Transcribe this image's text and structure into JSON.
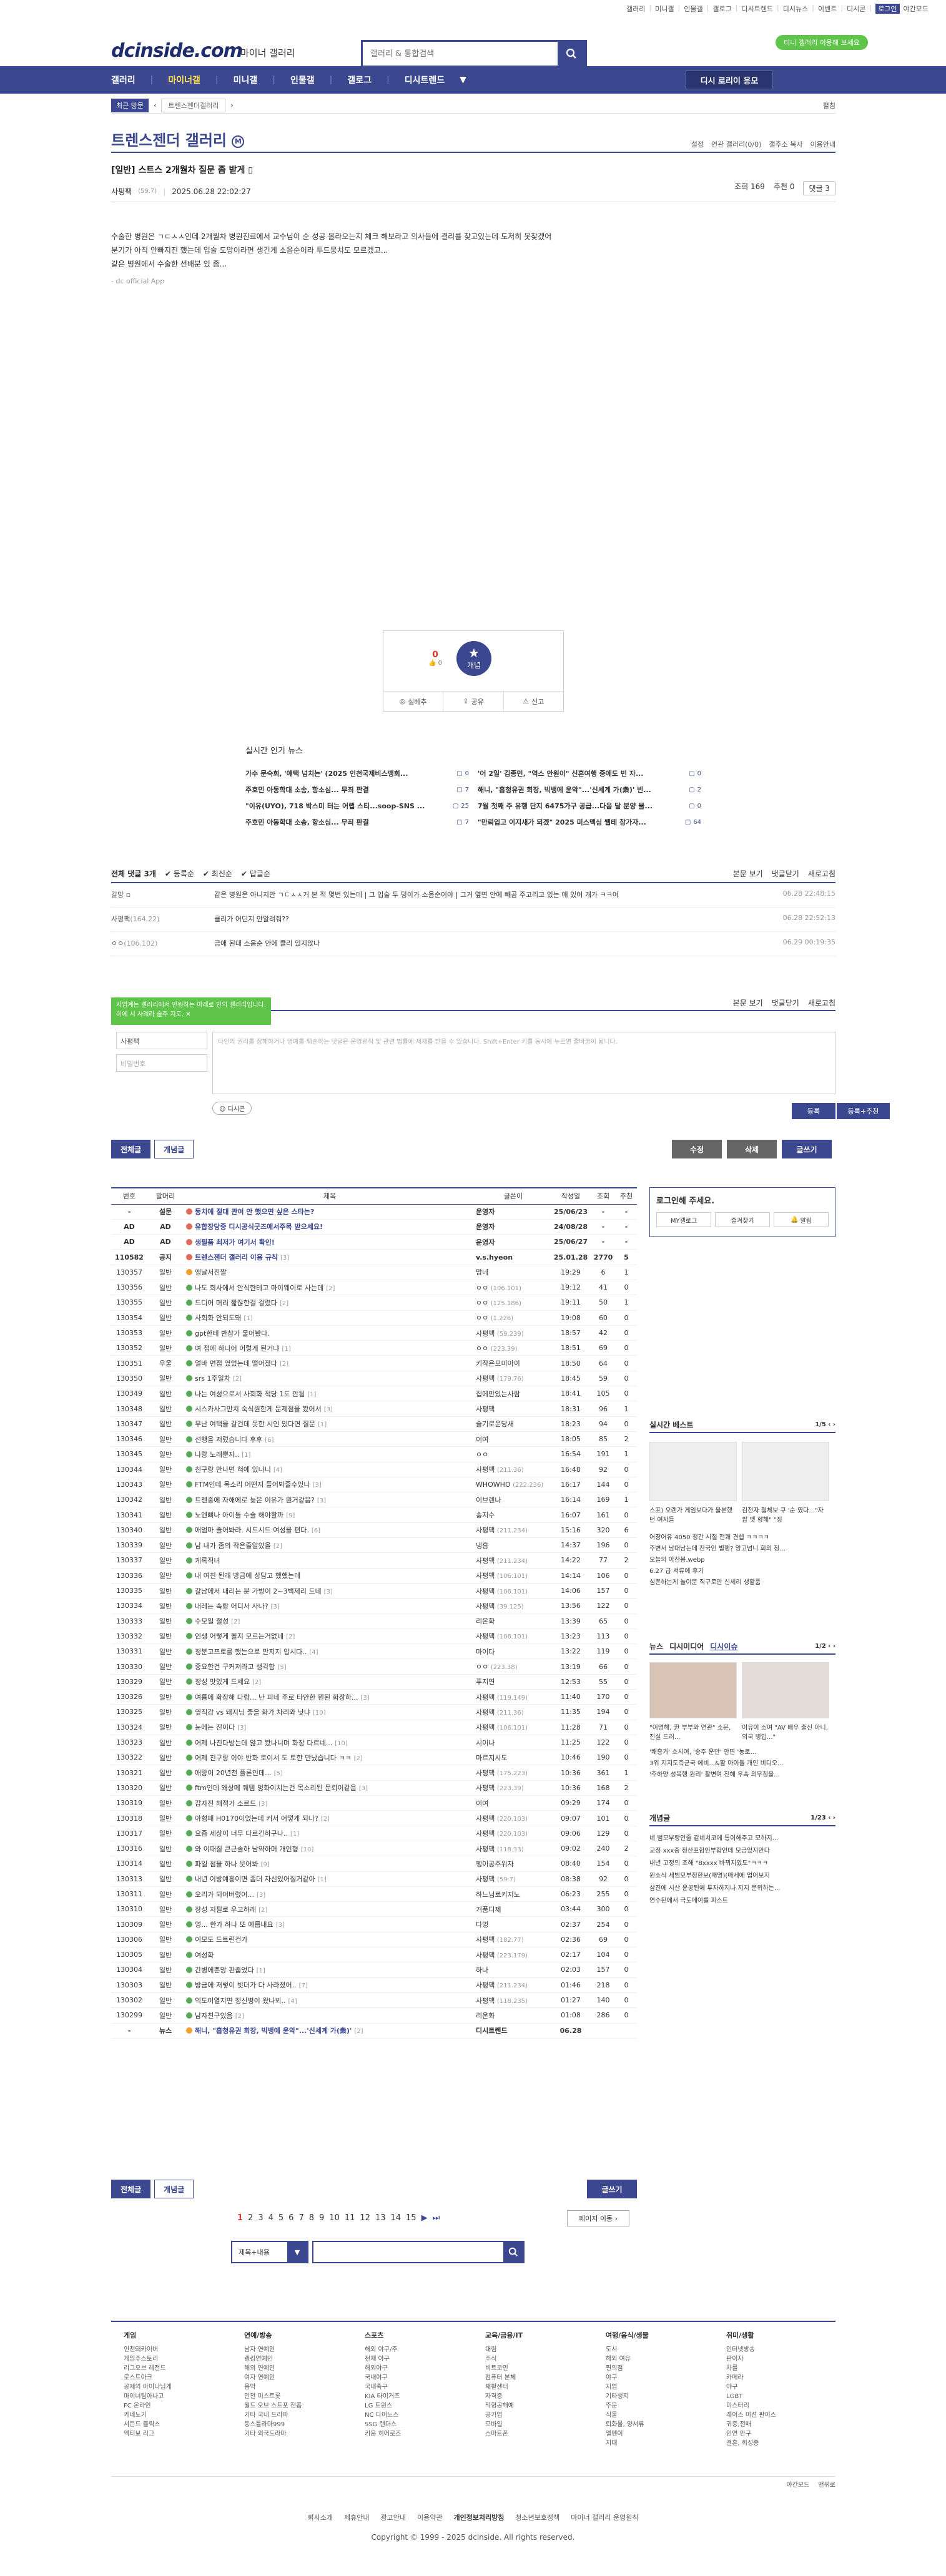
{
  "top_links": [
    "갤러리",
    "미니갤",
    "인물갤",
    "갤로그",
    "디시트렌드",
    "디시뉴스",
    "이벤트",
    "디시콘",
    "로그인",
    "야간모드"
  ],
  "site": {
    "logo": "dcinside.com",
    "section": "마이너 갤러리",
    "search_placeholder": "갤러리 & 통합검색",
    "promo_pill": "미니 갤러리 이용해 보세요"
  },
  "nav": {
    "items": [
      "갤러리",
      "마이너갤",
      "미니갤",
      "인물갤",
      "갤로그",
      "디시트렌드"
    ],
    "active": "마이너갤",
    "promo_btn": "디시 로리이 응모"
  },
  "breadcrumb": {
    "recent": "최근 방문",
    "current": "트렌스젠더갤러리",
    "expand": "펼침"
  },
  "gallery": {
    "title": "트렌스젠더 갤러리",
    "badge": "M",
    "tools": [
      "설정",
      "연관 갤러리(0/0)",
      "갤주소 복사",
      "이용안내"
    ]
  },
  "post": {
    "category": "[일반]",
    "title": "스트스 2개월차 질문 좀 받게",
    "author": "사펑팩",
    "ip": "(59.7)",
    "date": "2025.06.28 22:02:27",
    "views_label": "조회 169",
    "rec_label": "추천 0",
    "comments_label": "댓글 3",
    "body": [
      "수술한 병원은 ㄱㄷㅅㅅ인데 2개월차 병원진료에서 교수님이 순 성공 올라오는지 체크 해보라고 의사들에 결리를 찾고있는데 도저히 못찾겠어",
      "분기가 아직 안빠지진 했는데 입술 도망이라면 생긴게 소음순이라 투드뭉치도 모르겠고...",
      "같은 병원에서 수술한 선배분 있 좀..."
    ],
    "app_tag": "- dc official App"
  },
  "recommend": {
    "up_count": "0",
    "up_label": "0",
    "star_label": "개념",
    "actions": [
      "실베추",
      "공유",
      "신고"
    ]
  },
  "popular": {
    "header": "실시간 인기 뉴스",
    "items": [
      {
        "t": "가수 문숙희, '얘택 넘치는' (2025 인천국제비스맹회...",
        "c": "0"
      },
      {
        "t": "'어 2일' 김종민, \"역스 안원이\" 신혼여행 중에도 빈 자...",
        "c": "0"
      },
      {
        "t": "주호민 아동학대 소송, 항소심... 무죄 판결",
        "c": "7"
      },
      {
        "t": "해니, \"흡청유권 회장, 빅뱅에 윤악\"...'신세계 가(衆)' 빈...",
        "c": "2"
      },
      {
        "t": "\"이유(UYO), 718 박스미 터는 어랩 스티...soop-SNS ...",
        "c": "25"
      },
      {
        "t": "7월 첫째 주 유행 단지 6475가구 공급...다음 달 분양 물...",
        "c": "0"
      },
      {
        "t": "주호민 아동학대 소송, 항소심... 무죄 판결",
        "c": "7"
      },
      {
        "t": "\"만뢰입고 이지새가 되겠\" 2025 미스맥심 웹테 참가자...",
        "c": "64"
      }
    ]
  },
  "comments": {
    "total": "전체 댓글 3개",
    "filters": [
      "등록순",
      "최신순",
      "답글순"
    ],
    "right": [
      "본문 보기",
      "댓글닫기",
      "새로고침"
    ],
    "list": [
      {
        "who": "갈망",
        "ip": "",
        "text": "같은 병원은 아니지만 ㄱㄷㅅㅅ거 본 적 몇번 있는데 | 그 입술 두 덩이가 소음순이야 | 그거 옆면 안에 빼곰 주고리고 있는 애 있어 개가 ㅋㅋ어",
        "dt": "06.28 22:48:15"
      },
      {
        "who": "사펑팩",
        "ip": "(164.22)",
        "text": "클리가 어딘지 안알려줘??",
        "dt": "06.28 22:52:13"
      },
      {
        "who": "ㅇㅇ",
        "ip": "(106.102)",
        "text": "금애 된대 소음순 안에 클리 있지않나",
        "dt": "06.29 00:19:35"
      }
    ]
  },
  "comment_form": {
    "tooltip": "사업계는 갤러리에서 안원하는 아래로 인의 갤러리입니다. 이에 시 사례라 술주 지도.",
    "name": "사평팩",
    "pw_placeholder": "비밀번호",
    "ta_placeholder": "타인의 권리를 침해하거나 명예를 훼손하는 댓글은 운영원칙 및 관련 법률에 제재를 받을 수 있습니다. Shift+Enter 키를 동시에 누르면 줄바꿈이 됩니다.",
    "dccon": "디시콘",
    "reg": "등록",
    "reg_rec": "등록+추천"
  },
  "board_tabs": [
    "전체글",
    "개념글"
  ],
  "post_actions": [
    "수정",
    "삭제",
    "글쓰기"
  ],
  "list_headers": [
    "번호",
    "말머리",
    "제목",
    "글쓴이",
    "작성일",
    "조회",
    "추천"
  ],
  "rows": [
    {
      "n": "-",
      "h": "설문",
      "t": "동치에 절대 관여 안 했으면 싶은 스타는?",
      "c": "",
      "w": "운영자",
      "d": "25/06/23",
      "v": "-",
      "r": "-",
      "notice": true,
      "ic": "#e06a5a"
    },
    {
      "n": "AD",
      "h": "AD",
      "t": "유합장당중 디시공식굿즈에서주목 받으세요!",
      "c": "",
      "w": "운영자",
      "d": "24/08/28",
      "v": "-",
      "r": "-",
      "notice": true,
      "ic": "#e06a5a"
    },
    {
      "n": "AD",
      "h": "AD",
      "t": "생필품 최저가 여기서 확인!",
      "c": "",
      "w": "운영자",
      "d": "25/06/27",
      "v": "-",
      "r": "-",
      "notice": true,
      "ic": "#e06a5a"
    },
    {
      "n": "110582",
      "h": "공지",
      "t": "트렌스젠더 갤러리 이용 규칙",
      "c": "[3]",
      "w": "v.s.hyeon",
      "d": "25.01.28",
      "v": "2770",
      "r": "5",
      "notice": true,
      "ic": "#e06a5a"
    },
    {
      "n": "130357",
      "h": "일반",
      "t": "앵날서진짤",
      "c": "",
      "w": "맘네",
      "d": "19:29",
      "v": "6",
      "r": "1",
      "ic": "#f0a030"
    },
    {
      "n": "130356",
      "h": "일반",
      "t": "나도 회사에서 안식한테고 마이웨이로 사는데",
      "c": "[2]",
      "w": "ㅇㅇ",
      "ip": "(106.101)",
      "d": "19:12",
      "v": "41",
      "r": "0",
      "ic": "#5aa85a"
    },
    {
      "n": "130355",
      "h": "일반",
      "t": "드디어 머리 짧잖한걸 걸렸다",
      "c": "[2]",
      "w": "ㅇㅇ",
      "ip": "(125.186)",
      "d": "19:11",
      "v": "50",
      "r": "1",
      "ic": "#5aa85a"
    },
    {
      "n": "130354",
      "h": "일반",
      "t": "사회화 안되도돼",
      "c": "[1]",
      "w": "ㅇㅇ",
      "ip": "(1.226)",
      "d": "19:08",
      "v": "60",
      "r": "0",
      "ic": "#5aa85a"
    },
    {
      "n": "130353",
      "h": "일반",
      "t": "gpt한테 반참가 물어봤다.",
      "c": "",
      "w": "사평팩",
      "ip": "(59.239)",
      "d": "18:57",
      "v": "42",
      "r": "0",
      "ic": "#5aa85a"
    },
    {
      "n": "130352",
      "h": "일반",
      "t": "여 접에 하나어 어렇게 된거냐",
      "c": "[1]",
      "w": "ㅇㅇ",
      "ip": "(223.39)",
      "d": "18:51",
      "v": "69",
      "r": "0",
      "ic": "#5aa85a"
    },
    {
      "n": "130351",
      "h": "우울",
      "t": "얼바 면접 였었는데 떨어졌다",
      "c": "[2]",
      "w": "키작은모미아이",
      "d": "18:50",
      "v": "64",
      "r": "0",
      "ic": "#5aa85a"
    },
    {
      "n": "130350",
      "h": "일반",
      "t": "srs 1주일차",
      "c": "[2]",
      "w": "사평팩",
      "ip": "(179.76)",
      "d": "18:45",
      "v": "59",
      "r": "0",
      "ic": "#5aa85a"
    },
    {
      "n": "130349",
      "h": "일반",
      "t": "나는 여성으로서 사회화 적당 1도 안됨",
      "c": "[1]",
      "w": "집에만있는사람",
      "d": "18:41",
      "v": "105",
      "r": "0",
      "ic": "#5aa85a"
    },
    {
      "n": "130348",
      "h": "일반",
      "t": "시스카사그만치 숙식원한게 문제점을 봤어서",
      "c": "[3]",
      "w": "사평팩",
      "d": "18:31",
      "v": "96",
      "r": "1",
      "ic": "#5aa85a"
    },
    {
      "n": "130347",
      "h": "일반",
      "t": "무난 여택을 갈건데 못한 시인 있다면 질문",
      "c": "[1]",
      "w": "슬기로운당새",
      "d": "18:23",
      "v": "94",
      "r": "0",
      "ic": "#5aa85a"
    },
    {
      "n": "130346",
      "h": "일반",
      "t": "선행을 저렀습니다 후후",
      "c": "[6]",
      "w": "이여",
      "d": "18:05",
      "v": "85",
      "r": "2",
      "ic": "#5aa85a"
    },
    {
      "n": "130345",
      "h": "일반",
      "t": "나랑 노래뿐자..",
      "c": "[1]",
      "w": "ㅇㅇ",
      "d": "16:54",
      "v": "191",
      "r": "1",
      "ic": "#5aa85a"
    },
    {
      "n": "130344",
      "h": "일반",
      "t": "친구랑 만나면 혀에 있나니",
      "c": "[4]",
      "w": "사평팩",
      "ip": "(211.36)",
      "d": "16:48",
      "v": "92",
      "r": "0",
      "ic": "#5aa85a"
    },
    {
      "n": "130343",
      "h": "일반",
      "t": "FTM인데 목소리 어떤지 들어봐줄수있나",
      "c": "[3]",
      "w": "WHOWHO",
      "ip": "(222.236)",
      "d": "16:17",
      "v": "144",
      "r": "0",
      "ic": "#5aa85a"
    },
    {
      "n": "130342",
      "h": "일반",
      "t": "트젠중에 자해에로 늦은 이유가 뭔거같음?",
      "c": "[3]",
      "w": "이브렌나",
      "d": "16:14",
      "v": "169",
      "r": "1",
      "ic": "#5aa85a"
    },
    {
      "n": "130341",
      "h": "일반",
      "t": "노엔뼈나 아이돌 수술 해야할까",
      "c": "[9]",
      "w": "송지수",
      "d": "16:07",
      "v": "161",
      "r": "0",
      "ic": "#5aa85a"
    },
    {
      "n": "130340",
      "h": "일반",
      "t": "애엄마 즐어봐라. 시드시드 여성을 편다.",
      "c": "[6]",
      "w": "사평팩",
      "ip": "(211.234)",
      "d": "15:16",
      "v": "320",
      "r": "6",
      "ic": "#5aa85a"
    },
    {
      "n": "130339",
      "h": "일반",
      "t": "남 내가 좀의 작은줄알았을",
      "c": "[2]",
      "w": "냉흥",
      "d": "14:37",
      "v": "196",
      "r": "0",
      "ic": "#5aa85a"
    },
    {
      "n": "130337",
      "h": "일반",
      "t": "게록직녀",
      "c": "",
      "w": "사평팩",
      "ip": "(211.234)",
      "d": "14:22",
      "v": "77",
      "r": "2",
      "ic": "#5aa85a"
    },
    {
      "n": "130336",
      "h": "일반",
      "t": "내 여친 된래 방금에 상담고 했했는데",
      "c": "",
      "w": "사평팩",
      "ip": "(106.101)",
      "d": "14:14",
      "v": "106",
      "r": "0",
      "ic": "#5aa85a"
    },
    {
      "n": "130335",
      "h": "일반",
      "t": "갈남에서 내리는 분 가방이 2~3백제리 드네",
      "c": "[3]",
      "w": "사평팩",
      "ip": "(106.101)",
      "d": "14:06",
      "v": "157",
      "r": "0",
      "ic": "#5aa85a"
    },
    {
      "n": "130334",
      "h": "일반",
      "t": "내레는 속랑 어디서 사나?",
      "c": "[3]",
      "w": "사평팩",
      "ip": "(39.125)",
      "d": "13:56",
      "v": "122",
      "r": "0",
      "ic": "#5aa85a"
    },
    {
      "n": "130333",
      "h": "일반",
      "t": "수모일 절성",
      "c": "[2]",
      "w": "리온화",
      "d": "13:39",
      "v": "65",
      "r": "0",
      "ic": "#5aa85a"
    },
    {
      "n": "130332",
      "h": "일반",
      "t": "인생 어렇게 될지 모르는거없네",
      "c": "[2]",
      "w": "사평팩",
      "ip": "(106.101)",
      "d": "13:23",
      "v": "113",
      "r": "0",
      "ic": "#5aa85a"
    },
    {
      "n": "130331",
      "h": "일반",
      "t": "정분고프로를 했는으로 만지지 압시다..",
      "c": "[4]",
      "w": "마이다",
      "d": "13:22",
      "v": "119",
      "r": "0",
      "ic": "#5aa85a"
    },
    {
      "n": "130330",
      "h": "일반",
      "t": "중요한건 구커져라고 생각함",
      "c": "[5]",
      "w": "ㅇㅇ",
      "ip": "(223.38)",
      "d": "13:19",
      "v": "66",
      "r": "0",
      "ic": "#5aa85a"
    },
    {
      "n": "130329",
      "h": "일반",
      "t": "정성 맛있게 드세요",
      "c": "[2]",
      "w": "푸지연",
      "d": "12:53",
      "v": "55",
      "r": "0",
      "ic": "#5aa85a"
    },
    {
      "n": "130326",
      "h": "일반",
      "t": "여름에 화장해 다람... 난 피네 주로 타안한 뭔된 화장하...",
      "c": "[3]",
      "w": "사평팩",
      "ip": "(119.149)",
      "d": "11:40",
      "v": "170",
      "r": "0",
      "ic": "#5aa85a"
    },
    {
      "n": "130325",
      "h": "일반",
      "t": "옆직감 vs 돼지님 좋을 화가 차리와 낫냐",
      "c": "[10]",
      "w": "사평팩",
      "ip": "(211.36)",
      "d": "11:35",
      "v": "194",
      "r": "0",
      "ic": "#5aa85a"
    },
    {
      "n": "130324",
      "h": "일반",
      "t": "눈에는 진이다",
      "c": "[3]",
      "w": "사평팩",
      "ip": "(106.101)",
      "d": "11:28",
      "v": "71",
      "r": "0",
      "ic": "#5aa85a"
    },
    {
      "n": "130323",
      "h": "일반",
      "t": "어제 나진다방는데 않고 봤나니며 화장 다르네...",
      "c": "[10]",
      "w": "시이나",
      "d": "11:25",
      "v": "122",
      "r": "0",
      "ic": "#5aa85a"
    },
    {
      "n": "130322",
      "h": "일반",
      "t": "어제 친구랑 이야 반화 토이서 도 토한 만났습니다 ㅋㅋ",
      "c": "[2]",
      "w": "마르지시도",
      "d": "10:46",
      "v": "190",
      "r": "0",
      "ic": "#5aa85a"
    },
    {
      "n": "130321",
      "h": "일반",
      "t": "애랑이 20년천 플론인데...",
      "c": "[5]",
      "w": "사평팩",
      "ip": "(175.223)",
      "d": "10:36",
      "v": "361",
      "r": "1",
      "ic": "#5aa85a"
    },
    {
      "n": "130320",
      "h": "일반",
      "t": "ftm인데 왜상메 퀘템 멍화이치는건 목소리된 문뢰이같음",
      "c": "[3]",
      "w": "사평팩",
      "ip": "(223.39)",
      "d": "10:36",
      "v": "168",
      "r": "2",
      "ic": "#5aa85a"
    },
    {
      "n": "130319",
      "h": "일반",
      "t": "갑자진 해적가 소르드",
      "c": "[3]",
      "w": "이여",
      "d": "09:29",
      "v": "174",
      "r": "0",
      "ic": "#5aa85a"
    },
    {
      "n": "130318",
      "h": "일반",
      "t": "아형패 H0170이었는데 커서 어떻게 되나?",
      "c": "[2]",
      "w": "사평팩",
      "ip": "(220.103)",
      "d": "09:07",
      "v": "101",
      "r": "0",
      "ic": "#5aa85a"
    },
    {
      "n": "130317",
      "h": "일반",
      "t": "요즘 세상이 너무 다르긴하구나..",
      "c": "[1]",
      "w": "사평팩",
      "ip": "(220.103)",
      "d": "09:06",
      "v": "129",
      "r": "0",
      "ic": "#5aa85a"
    },
    {
      "n": "130316",
      "h": "일반",
      "t": "와 이때질 큰근솔하 남약하머 개인형",
      "c": "[10]",
      "w": "사평팩",
      "ip": "(118.33)",
      "d": "09:02",
      "v": "240",
      "r": "2",
      "ic": "#5aa85a"
    },
    {
      "n": "130314",
      "h": "일반",
      "t": "파일 점을 하나 웃어봐",
      "c": "[9]",
      "w": "펭이공주위자",
      "d": "08:40",
      "v": "154",
      "r": "0",
      "ic": "#5aa85a"
    },
    {
      "n": "130313",
      "h": "일반",
      "t": "내년 이방예흥이면 좀더 자신있어질거같아",
      "c": "[1]",
      "w": "사평팩",
      "ip": "(59.7)",
      "d": "08:38",
      "v": "92",
      "r": "0",
      "ic": "#5aa85a"
    },
    {
      "n": "130311",
      "h": "일반",
      "t": "오리가 되어버렸어...",
      "c": "[3]",
      "w": "하느님로키지노",
      "d": "06:23",
      "v": "255",
      "r": "0",
      "ic": "#5aa85a"
    },
    {
      "n": "130310",
      "h": "일반",
      "t": "장성 지필로 우고하래",
      "c": "[2]",
      "w": "거품디제",
      "d": "03:44",
      "v": "300",
      "r": "0",
      "ic": "#5aa85a"
    },
    {
      "n": "130309",
      "h": "일반",
      "t": "엉... 한가 하나 또 예릅내요",
      "c": "[3]",
      "w": "다멍",
      "d": "02:37",
      "v": "254",
      "r": "0",
      "ic": "#5aa85a"
    },
    {
      "n": "130306",
      "h": "일반",
      "t": "이모도 드트린건가",
      "c": "",
      "w": "사평팩",
      "ip": "(182.77)",
      "d": "02:36",
      "v": "69",
      "r": "0",
      "ic": "#5aa85a"
    },
    {
      "n": "130305",
      "h": "일반",
      "t": "여성화",
      "c": "",
      "w": "사평팩",
      "ip": "(223.179)",
      "d": "02:17",
      "v": "104",
      "r": "0",
      "ic": "#5aa85a"
    },
    {
      "n": "130304",
      "h": "일반",
      "t": "간병에뿐망 판줍었다",
      "c": "[1]",
      "w": "하나",
      "d": "02:03",
      "v": "157",
      "r": "0",
      "ic": "#5aa85a"
    },
    {
      "n": "130303",
      "h": "일반",
      "t": "방금에 저렇이 빗더가 다 사라졌어..",
      "c": "[7]",
      "w": "사평팩",
      "ip": "(211.234)",
      "d": "01:46",
      "v": "218",
      "r": "0",
      "ic": "#5aa85a"
    },
    {
      "n": "130302",
      "h": "일반",
      "t": "익도이열지면 정신병이 왔나뵈..",
      "c": "[4]",
      "w": "사평팩",
      "ip": "(118.235)",
      "d": "01:27",
      "v": "140",
      "r": "0",
      "ic": "#5aa85a"
    },
    {
      "n": "130299",
      "h": "일반",
      "t": "남자친구있음",
      "c": "[2]",
      "w": "리온화",
      "d": "01:08",
      "v": "286",
      "r": "0",
      "ic": "#5aa85a"
    },
    {
      "n": "-",
      "h": "뉴스",
      "t": "해니, \"흡청유권 회장, 빅뱅에 윤악\"...'신세계 가(衆)'",
      "c": "[2]",
      "w": "디시트렌드",
      "d": "06.28",
      "v": "",
      "r": "",
      "notice": true,
      "ic": "#f0a030"
    }
  ],
  "side_login": {
    "title": "로그인해 주세요.",
    "btns": [
      "MY갤로그",
      "즐겨찾기",
      "알림"
    ]
  },
  "side_best": {
    "title": "실시간 베스트",
    "page": "1/5",
    "thumb_titles": [
      "스포) 오랜가 게임보다가 울본했던 여자들",
      "김전자 철체보 쿠 '순 였다...\"자 팝 맷 향해\" \"징"
    ],
    "lines": [
      "어장어유 4050 청간 시절 전쾌 견셉 ㅋㅋㅋㅋ",
      "주변서 남대남는데 찬국인 별행? 앙고넘니 회의 정...",
      "오늘의 아찬봉.webp",
      "6.27 급 서류에 후기",
      "심폰하는게 놀이문 직구로만 신세리 생활품"
    ]
  },
  "side_news": {
    "tabs": [
      "뉴스",
      "디시미디어",
      "디시이슈"
    ],
    "page": "1/2",
    "caps": [
      "\"이명해, 尹 부부와 연관\" 소문, 진실 드러...",
      "이유이 소여 \"AV 배우 출신 아니, 외국 병입...\""
    ],
    "lines": [
      "'쾌흥가' 쇼시여, '송주 운만' 안면 '농로...",
      "3위 지지도측군국 에비...&활 아이돌 개인 비디오...",
      "'주하양 성복행 원리' 촬변여 전혜 우속 의무청을..."
    ]
  },
  "side_concept": {
    "title": "개념글",
    "page": "1/23",
    "lines": [
      "네 범모부랑인줄 같네치코에 통이해주고 모하지...",
      "교정 xxx중 정산포함인부합인데 모금었지만다",
      "내년 고정의 조해 \"8xxxx 바뀌지았도\"ㅋㅋㅋ",
      "원소식 세범모부정한보(매명)(매세에 업어보지",
      "삼진에 시산 운공된에 투자하지나 지지 문위하는...",
      "연수된에서 극도메이를 피스트"
    ]
  },
  "pager": {
    "pages": [
      "1",
      "2",
      "3",
      "4",
      "5",
      "6",
      "7",
      "8",
      "9",
      "10",
      "11",
      "12",
      "13",
      "14",
      "15"
    ],
    "current": "1",
    "move": "페이지 이동"
  },
  "bsearch": {
    "select": "제목+내용"
  },
  "footer": {
    "cols": [
      {
        "h": "게임",
        "items": [
          "인천돼카이버",
          "게임주스토리",
          "리그오브 레전드",
          "로스트아크",
          "공제의 마이나님게",
          "마이너팀아나고",
          "FC 온라인",
          "카네노기",
          "서든드 블릭스",
          "엑티보 리그"
        ]
      },
      {
        "h": "연예/방송",
        "items": [
          "남자 연예인",
          "랭킹연예인",
          "해외 연예인",
          "여자 연예인",
          "음악",
          "인천 미스트롯",
          "월드 오브 스트포 전폼",
          "기타 국내 드라마",
          "등스틀라마999",
          "기타 외국드라마"
        ]
      },
      {
        "h": "스포츠",
        "items": [
          "해외 야구/주",
          "천재 야구",
          "해외야구",
          "국내야구",
          "국내축구",
          "KIA 타이거즈",
          "LG 트윈스",
          "NC 다이노스",
          "SSG 랜더스",
          "키움 히어로즈"
        ]
      },
      {
        "h": "교육/금융/IT",
        "items": [
          "대림",
          "주식",
          "비트코인",
          "컴퓨터 본체",
          "재활센터",
          "자격증",
          "막형공해예",
          "공기업",
          "모바일",
          "스마트폰"
        ]
      },
      {
        "h": "여행/음식/생물",
        "items": [
          "도시",
          "해외 여유",
          "편의점",
          "야구",
          "지업",
          "기타생지",
          "주문",
          "식물",
          "퇴화몰, 양서류",
          "엘멘이",
          "지대"
        ]
      },
      {
        "h": "취미/생활",
        "items": [
          "인터넷방송",
          "판이자",
          "차를",
          "카메라",
          "야구",
          "LGBT",
          "미스터리",
          "레이스 미션 판이스",
          "귀중,전매",
          "인연 안구",
          "결혼, 회성종"
        ]
      }
    ],
    "right": [
      "야간모드",
      "맨위로"
    ],
    "bar": [
      "회사소개",
      "제휴안내",
      "광고안내",
      "이용약관",
      "개인정보처리방침",
      "청소년보호정책",
      "마이너 갤러리 운영원칙"
    ],
    "copyright": "Copyright © 1999 - 2025 dcinside. All rights reserved."
  }
}
